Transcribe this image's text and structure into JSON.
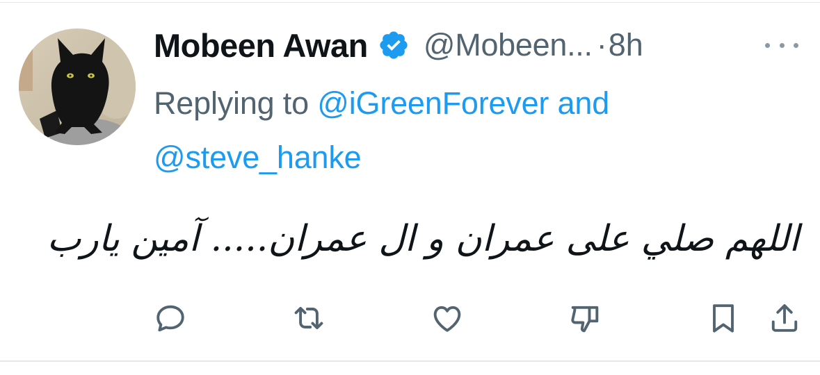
{
  "tweet": {
    "author": {
      "display_name": "Mobeen Awan",
      "handle": "@Mobeen...",
      "verified": true,
      "avatar": "black-cat-photo"
    },
    "separator": "·",
    "timestamp": "8h",
    "reply_to": {
      "prefix": "Replying to ",
      "mentions": [
        "@iGreenForever",
        "@steve_hanke"
      ],
      "joiner": " and "
    },
    "text": "اللھم صلي على عمران و ال عمران..... آمين يارب"
  },
  "actions": [
    {
      "name": "reply",
      "icon": "reply-icon"
    },
    {
      "name": "retweet",
      "icon": "retweet-icon"
    },
    {
      "name": "like",
      "icon": "heart-icon"
    },
    {
      "name": "downvote",
      "icon": "downvote-icon"
    },
    {
      "name": "bookmark",
      "icon": "bookmark-icon"
    },
    {
      "name": "share",
      "icon": "share-icon"
    }
  ],
  "colors": {
    "link": "#1d9bf0",
    "secondary_text": "#536471",
    "primary_text": "#0f1419",
    "icon": "#536471"
  }
}
